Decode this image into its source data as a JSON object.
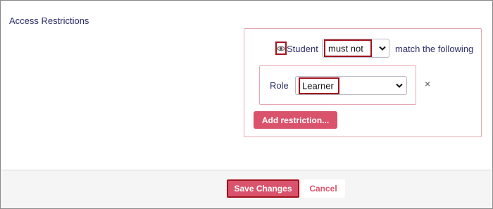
{
  "section": {
    "title": "Access Restrictions"
  },
  "restriction": {
    "subject_label": "Student",
    "operator_value": "must not",
    "match_label": "match the following",
    "visibility_icon": "eye-icon",
    "rule": {
      "field_label": "Role",
      "value": "Learner",
      "remove_symbol": "×"
    },
    "add_button_label": "Add restriction..."
  },
  "footer": {
    "save_label": "Save Changes",
    "cancel_label": "Cancel"
  },
  "colors": {
    "accent": "#d9536c",
    "highlight_border": "#a1121c",
    "label_text": "#2d2f6b",
    "panel_border": "#e7a7b3"
  }
}
